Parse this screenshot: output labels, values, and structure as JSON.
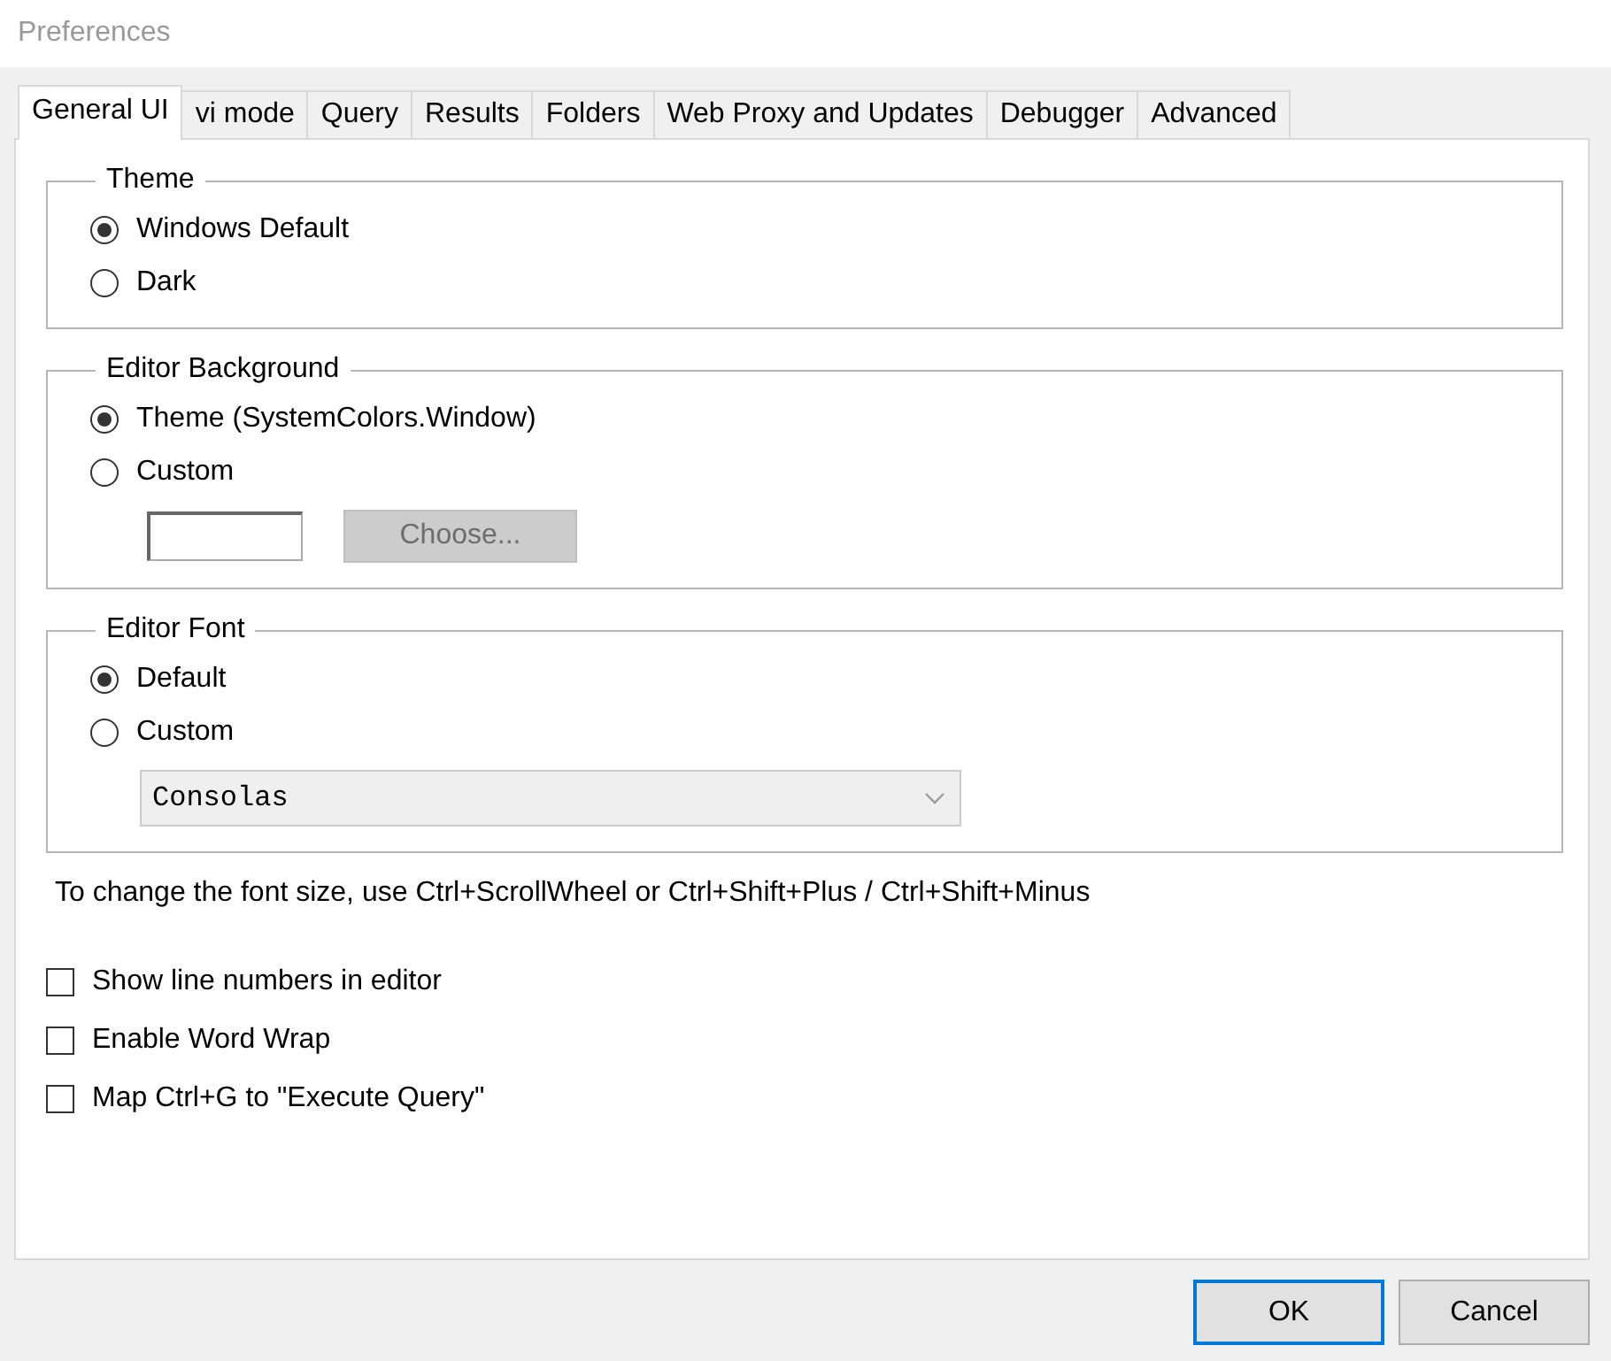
{
  "window": {
    "title": "Preferences"
  },
  "tabs": [
    {
      "label": "General UI",
      "selected": true
    },
    {
      "label": "vi mode",
      "selected": false
    },
    {
      "label": "Query",
      "selected": false
    },
    {
      "label": "Results",
      "selected": false
    },
    {
      "label": "Folders",
      "selected": false
    },
    {
      "label": "Web Proxy and Updates",
      "selected": false
    },
    {
      "label": "Debugger",
      "selected": false
    },
    {
      "label": "Advanced",
      "selected": false
    }
  ],
  "groups": [
    {
      "title": "Theme",
      "options": [
        {
          "label": "Windows Default",
          "selected": true
        },
        {
          "label": "Dark",
          "selected": false
        }
      ]
    },
    {
      "title": "Editor Background",
      "options": [
        {
          "label": "Theme (SystemColors.Window)",
          "selected": true
        },
        {
          "label": "Custom",
          "selected": false
        }
      ],
      "extra": {
        "kind": "color",
        "button": "Choose...",
        "disabled": true
      }
    },
    {
      "title": "Editor Font",
      "options": [
        {
          "label": "Default",
          "selected": true
        },
        {
          "label": "Custom",
          "selected": false
        }
      ],
      "extra": {
        "kind": "dropdown",
        "value": "Consolas",
        "disabled": true
      }
    }
  ],
  "hint": "To change the font size, use Ctrl+ScrollWheel or Ctrl+Shift+Plus / Ctrl+Shift+Minus",
  "checkboxes": [
    {
      "label": "Show line numbers in editor",
      "checked": false
    },
    {
      "label": "Enable Word Wrap",
      "checked": false
    },
    {
      "label": "Map Ctrl+G to \"Execute Query\"",
      "checked": false
    }
  ],
  "buttons": [
    {
      "label": "OK",
      "default": true
    },
    {
      "label": "Cancel",
      "default": false
    }
  ]
}
